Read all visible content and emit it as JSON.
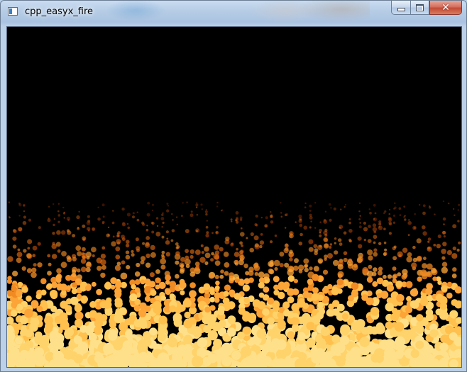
{
  "window": {
    "title": "cpp_easyx_fire",
    "icon": "app-window-icon",
    "buttons": {
      "minimize_icon": "minimize-icon",
      "maximize_icon": "maximize-icon",
      "close_glyph": "✕"
    }
  },
  "canvas": {
    "background": "#000000",
    "particle_palette": [
      "#ffe08a",
      "#ffd36b",
      "#ffc04d",
      "#fca437",
      "#f08a22",
      "#dd6a12",
      "#c04d0a",
      "#9c3506"
    ]
  }
}
